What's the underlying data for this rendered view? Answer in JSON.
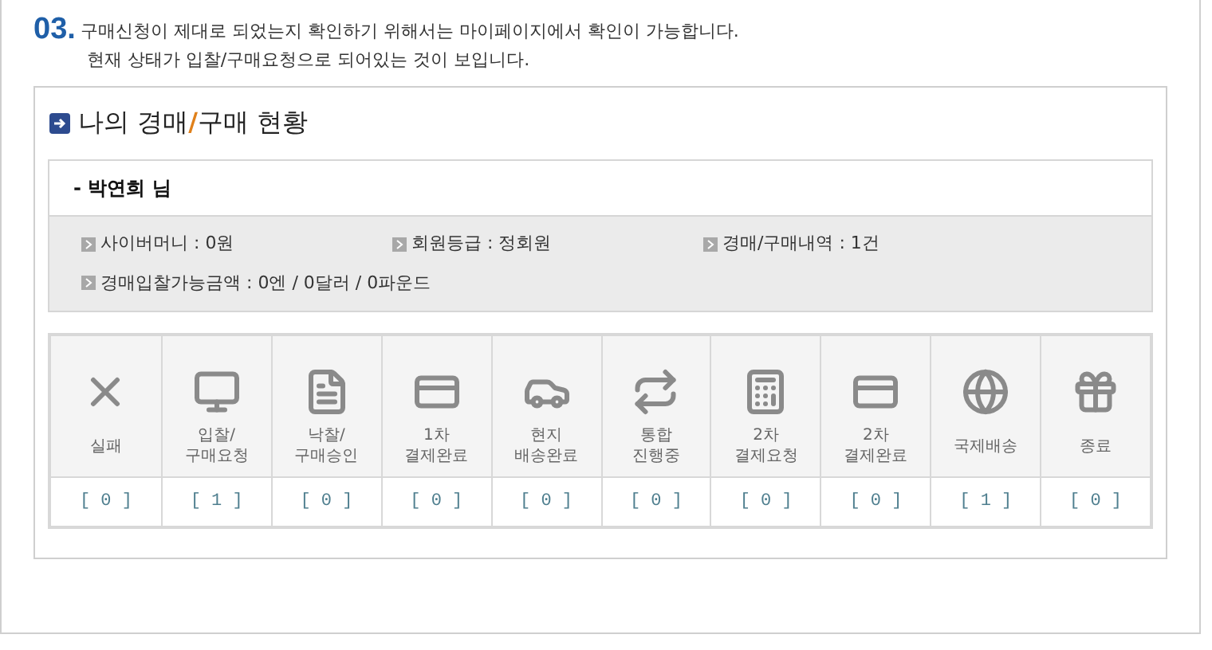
{
  "step": {
    "number": "03.",
    "lines": [
      "구매신청이 제대로 되었는지 확인하기 위해서는 마이페이지에서 확인이 가능합니다.",
      "현재 상태가 입찰/구매요청으로 되어있는 것이 보입니다."
    ]
  },
  "panel": {
    "title_parts": [
      "나의 경매",
      "/",
      "구매 현황"
    ],
    "member": {
      "name": "- 박연희 님",
      "info": [
        "사이버머니 : 0원",
        "회원등급 : 정회원",
        "경매/구매내역 : 1건",
        "경매입찰가능금액 : 0엔 / 0달러 / 0파운드"
      ]
    },
    "statuses": [
      {
        "label": [
          "실패"
        ],
        "count": "[ 0 ]"
      },
      {
        "label": [
          "입찰/",
          "구매요청"
        ],
        "count": "[ 1 ]"
      },
      {
        "label": [
          "낙찰/",
          "구매승인"
        ],
        "count": "[ 0 ]"
      },
      {
        "label": [
          "1차",
          "결제완료"
        ],
        "count": "[ 0 ]"
      },
      {
        "label": [
          "현지",
          "배송완료"
        ],
        "count": "[ 0 ]"
      },
      {
        "label": [
          "통합",
          "진행중"
        ],
        "count": "[ 0 ]"
      },
      {
        "label": [
          "2차",
          "결제요청"
        ],
        "count": "[ 0 ]"
      },
      {
        "label": [
          "2차",
          "결제완료"
        ],
        "count": "[ 0 ]"
      },
      {
        "label": [
          "국제배송"
        ],
        "count": "[ 1 ]"
      },
      {
        "label": [
          "종료"
        ],
        "count": "[ 0 ]"
      }
    ]
  }
}
